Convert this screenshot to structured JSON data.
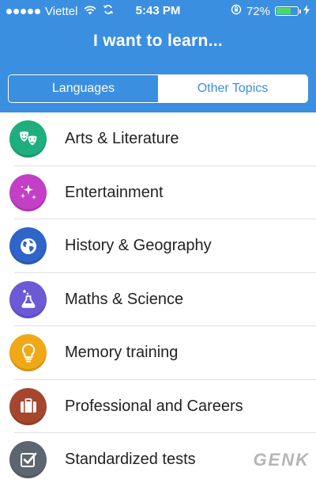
{
  "status_bar": {
    "carrier": "Viettel",
    "time": "5:43 PM",
    "battery_percent": "72%",
    "battery_level": 0.72,
    "icons": [
      "signal-dots-icon",
      "wifi-icon",
      "sync-icon",
      "rotation-lock-icon",
      "battery-icon",
      "charging-icon"
    ]
  },
  "header": {
    "title": "I want to learn...",
    "background_color": "#3b8fe0"
  },
  "tabs": [
    {
      "label": "Languages",
      "selected": true
    },
    {
      "label": "Other Topics",
      "selected": false
    }
  ],
  "categories": [
    {
      "label": "Arts & Literature",
      "icon": "theater-masks-icon",
      "color": "#1fae7e"
    },
    {
      "label": "Entertainment",
      "icon": "sparkles-icon",
      "color": "#c23fc6"
    },
    {
      "label": "History & Geography",
      "icon": "globe-icon",
      "color": "#2f64c9"
    },
    {
      "label": "Maths & Science",
      "icon": "flask-icon",
      "color": "#6b59d6"
    },
    {
      "label": "Memory training",
      "icon": "lightbulb-icon",
      "color": "#f0a818"
    },
    {
      "label": "Professional and Careers",
      "icon": "briefcase-icon",
      "color": "#a6462f"
    },
    {
      "label": "Standardized tests",
      "icon": "checkbox-icon",
      "color": "#5d6670"
    }
  ],
  "watermark": "GENK"
}
